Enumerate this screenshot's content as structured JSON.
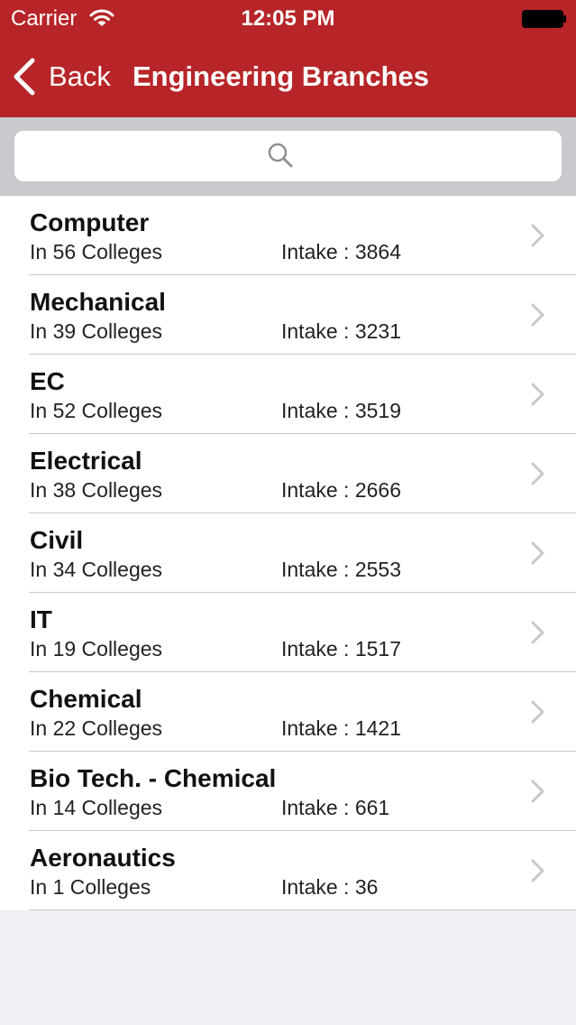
{
  "status_bar": {
    "carrier": "Carrier",
    "time": "12:05 PM"
  },
  "nav": {
    "back_label": "Back",
    "title": "Engineering Branches"
  },
  "search": {
    "value": "",
    "placeholder": ""
  },
  "colors": {
    "accent": "#b72528",
    "search_background": "#c9c9ce",
    "page_background": "#efeff4",
    "separator": "#c8c7cc",
    "chevron": "#c7c7cc"
  },
  "icons": {
    "back": "chevron-left-icon",
    "search": "search-icon",
    "row_disclosure": "chevron-right-icon",
    "wifi": "wifi-icon",
    "battery": "battery-icon"
  },
  "branches": [
    {
      "name": "Computer",
      "colleges": "In 56 Colleges",
      "intake": "Intake : 3864"
    },
    {
      "name": "Mechanical",
      "colleges": "In 39 Colleges",
      "intake": "Intake : 3231"
    },
    {
      "name": "EC",
      "colleges": "In 52 Colleges",
      "intake": "Intake : 3519"
    },
    {
      "name": "Electrical",
      "colleges": "In 38 Colleges",
      "intake": "Intake : 2666"
    },
    {
      "name": "Civil",
      "colleges": "In 34 Colleges",
      "intake": "Intake : 2553"
    },
    {
      "name": "IT",
      "colleges": "In 19 Colleges",
      "intake": "Intake : 1517"
    },
    {
      "name": "Chemical",
      "colleges": "In 22 Colleges",
      "intake": "Intake : 1421"
    },
    {
      "name": "Bio Tech. - Chemical",
      "colleges": "In 14 Colleges",
      "intake": "Intake : 661"
    },
    {
      "name": "Aeronautics",
      "colleges": "In 1 Colleges",
      "intake": "Intake : 36"
    }
  ]
}
